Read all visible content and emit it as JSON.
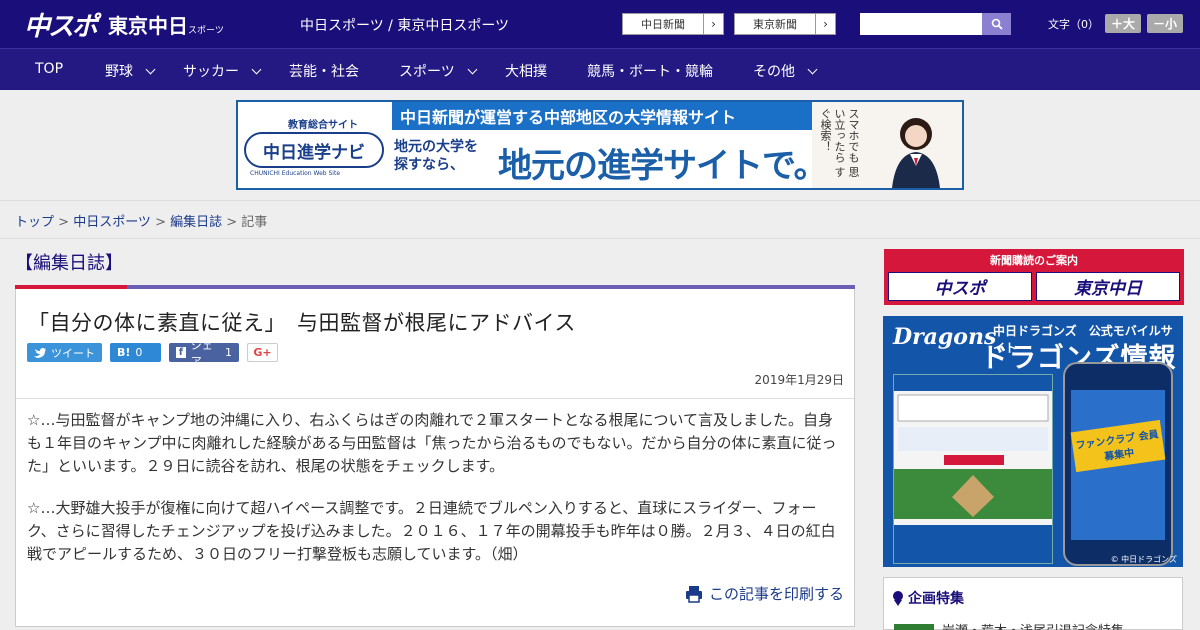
{
  "header": {
    "logo_main": "中スポ",
    "logo_sub": "東京中日",
    "logo_sub_small": "スポーツ",
    "site_link": "中日スポーツ / 東京中日スポーツ",
    "ext_links": [
      "中日新聞",
      "東京新聞"
    ],
    "search_placeholder": "",
    "fontsize_label": "文字（0）",
    "fontsize_up": "＋大",
    "fontsize_down": "－小"
  },
  "nav": {
    "items": [
      {
        "label": "TOP",
        "dropdown": false
      },
      {
        "label": "野球",
        "dropdown": true
      },
      {
        "label": "サッカー",
        "dropdown": true
      },
      {
        "label": "芸能・社会",
        "dropdown": false
      },
      {
        "label": "スポーツ",
        "dropdown": true
      },
      {
        "label": "大相撲",
        "dropdown": false
      },
      {
        "label": "競馬・ボート・競輪",
        "dropdown": false
      },
      {
        "label": "その他",
        "dropdown": true
      }
    ]
  },
  "banner": {
    "brand_small": "教育総合サイト",
    "brand": "中日進学ナビ",
    "brand_en": "CHUNICHI Education Web Site",
    "strip": "中日新聞が運営する中部地区の大学情報サイト",
    "sub": "地元の大学を\n探すなら、",
    "big": "地元の進学サイトで。",
    "vertical": "スマホでも 思い立ったら すぐ検索！"
  },
  "breadcrumb": {
    "items": [
      "トップ",
      "中日スポーツ",
      "編集日誌"
    ],
    "current": "記事",
    "separator": " > "
  },
  "section_title": "【編集日誌】",
  "article": {
    "headline": "「自分の体に素直に従え」　与田監督が根尾にアドバイス",
    "share": {
      "tweet": "ツイート",
      "hatena": "B!",
      "hatena_count": "0",
      "fb": "シェア",
      "fb_count": "1",
      "gplus": "G+"
    },
    "date": "2019年1月29日",
    "paragraphs": [
      "☆…与田監督がキャンプ地の沖縄に入り、右ふくらはぎの肉離れで２軍スタートとなる根尾について言及しました。自身も１年目のキャンプ中に肉離れした経験がある与田監督は「焦ったから治るものでもない。だから自分の体に素直に従った」といいます。２９日に読谷を訪れ、根尾の状態をチェックします。",
      "☆…大野雄大投手が復権に向けて超ハイペース調整です。２日連続でブルペン入りすると、直球にスライダー、フォーク、さらに習得したチェンジアップを投げ込みました。２０１６、１７年の開幕投手も昨年は０勝。２月３、４日の紅白戦でアピールするため、３０日のフリー打撃登板も志願しています。（畑）"
    ],
    "print": "この記事を印刷する"
  },
  "sidebar": {
    "subscribe_header": "新聞購読のご案内",
    "subscribe_buttons": [
      "中スポ",
      "東京中日"
    ],
    "dragons": {
      "logo": "Dragons",
      "title_small": "中日ドラゴンズ　公式モバイルサイト",
      "title": "ドラゴンズ情報",
      "badge": "ファンクラブ 会員募集中",
      "copyright": "© 中日ドラゴンズ"
    },
    "kikaku": {
      "header": "企画特集",
      "item": "岩瀬・荒木・浅尾引退記念特集"
    }
  },
  "colors": {
    "header_bg": "#1a0e7a",
    "nav_bg": "#241883",
    "accent_red": "#d4173b",
    "accent_purple": "#6b5fb5",
    "link": "#1a3a8a"
  }
}
